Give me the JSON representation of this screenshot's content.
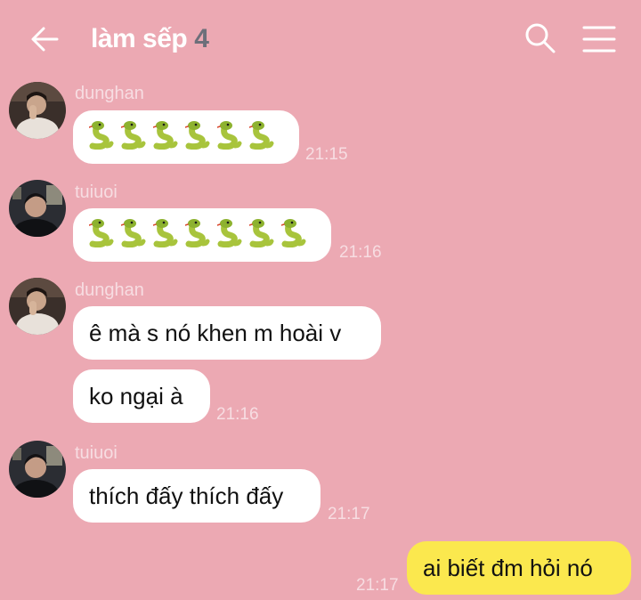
{
  "header": {
    "title": "làm sếp",
    "member_count": "4",
    "back_icon": "arrow-left-icon",
    "search_icon": "search-icon",
    "menu_icon": "hamburger-menu-icon"
  },
  "colors": {
    "background": "#eca9b3",
    "incoming_bubble": "#ffffff",
    "outgoing_bubble": "#fbe84e",
    "meta_text": "#f7dde2"
  },
  "messages": [
    {
      "sender": "dunghan",
      "content": "🐍🐍🐍🐍🐍🐍",
      "snake_count": 6,
      "time": "21:15"
    },
    {
      "sender": "tuiuoi",
      "content": "🐍🐍🐍🐍🐍🐍🐍",
      "snake_count": 7,
      "time": "21:16"
    },
    {
      "sender": "dunghan",
      "text": "ê mà s nó khen m hoài v"
    },
    {
      "text": "ko ngại à",
      "time": "21:16"
    },
    {
      "sender": "tuiuoi",
      "text": "thích đấy thích đấy",
      "time": "21:17"
    },
    {
      "text": "ai biết đm hỏi nó",
      "time": "21:17",
      "outgoing": true
    }
  ]
}
